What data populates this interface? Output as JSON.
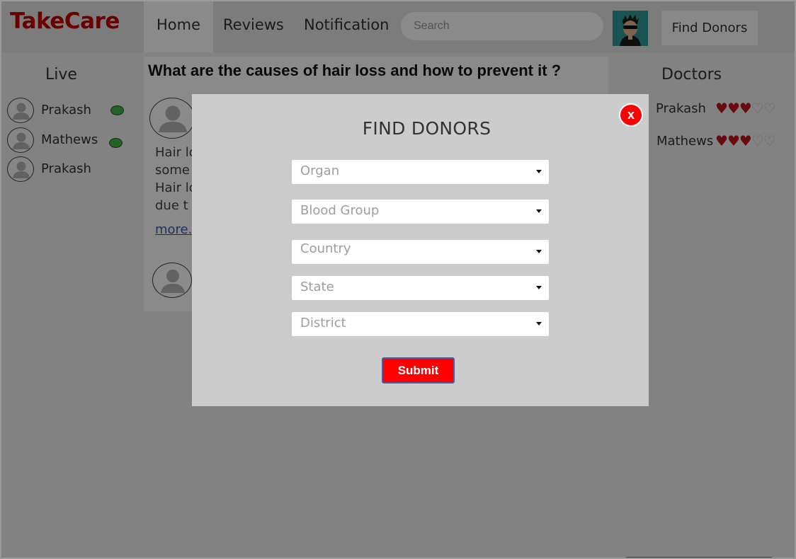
{
  "app": {
    "name": "TakeCare"
  },
  "nav": {
    "items": [
      {
        "label": "Home",
        "active": true
      },
      {
        "label": "Reviews",
        "active": false
      },
      {
        "label": "Notification",
        "active": false
      }
    ],
    "search_placeholder": "Search",
    "find_donors_label": "Find Donors"
  },
  "live": {
    "title": "Live",
    "users": [
      {
        "name": "Prakash",
        "online": true
      },
      {
        "name": "Mathews",
        "online": true
      },
      {
        "name": "Prakash",
        "online": false
      }
    ]
  },
  "post": {
    "title": "What are the causes of hair loss and how to prevent it ?",
    "body_lines": [
      "Hair lo",
      "some",
      "Hair lo",
      "due t"
    ],
    "more_label": "more..."
  },
  "doctors": {
    "title": "Doctors",
    "list": [
      {
        "name": "Prakash",
        "rating": 3,
        "max": 5
      },
      {
        "name": "Mathews",
        "rating": 3,
        "max": 5
      }
    ]
  },
  "modal": {
    "title": "FIND DONORS",
    "close_label": "x",
    "fields": [
      {
        "placeholder": "Organ"
      },
      {
        "placeholder": "Blood Group"
      },
      {
        "placeholder": "Country"
      },
      {
        "placeholder": "State"
      },
      {
        "placeholder": "District"
      }
    ],
    "submit_label": "Submit"
  },
  "colors": {
    "brand": "#c00000",
    "online": "#3fb53f",
    "accent": "#ff0000",
    "heart": "#c0141c"
  }
}
